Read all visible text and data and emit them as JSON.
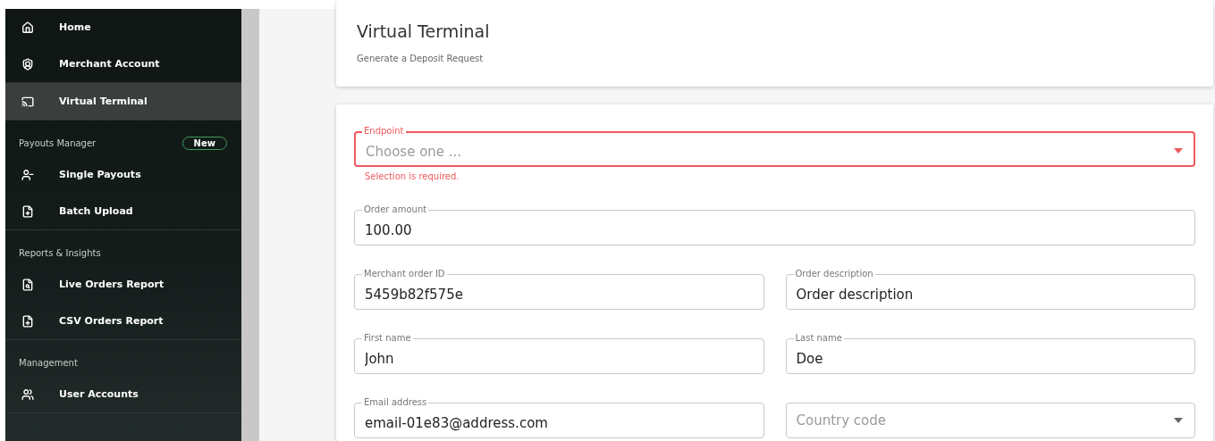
{
  "sidebar": {
    "sections": [
      {
        "items": [
          {
            "label": "Home",
            "selected": false
          },
          {
            "label": "Merchant Account",
            "selected": false
          }
        ]
      },
      {
        "items": [
          {
            "label": "Virtual Terminal",
            "selected": true
          }
        ]
      },
      {
        "heading": "Payouts Manager",
        "badge": "New",
        "items": [
          {
            "label": "Single Payouts",
            "selected": false
          },
          {
            "label": "Batch Upload",
            "selected": false
          }
        ]
      },
      {
        "heading": "Reports & Insights",
        "items": [
          {
            "label": "Live Orders Report",
            "selected": false
          },
          {
            "label": "CSV Orders Report",
            "selected": false
          }
        ]
      },
      {
        "heading": "Management",
        "items": [
          {
            "label": "User Accounts",
            "selected": false
          }
        ]
      }
    ]
  },
  "header": {
    "title": "Virtual Terminal",
    "subtitle": "Generate a Deposit Request"
  },
  "form": {
    "rows": [
      [
        {
          "kind": "select",
          "label": "Endpoint",
          "placeholder": "Choose one ...",
          "error": "Selection is required."
        }
      ],
      [
        {
          "kind": "text",
          "label": "Order amount",
          "value": "100.00"
        }
      ],
      [
        {
          "kind": "text",
          "label": "Merchant order ID",
          "value": "5459b82f575e"
        },
        {
          "kind": "text",
          "label": "Order description",
          "value": "Order description"
        }
      ],
      [
        {
          "kind": "text",
          "label": "First name",
          "value": "John"
        },
        {
          "kind": "text",
          "label": "Last name",
          "value": "Doe"
        }
      ],
      [
        {
          "kind": "text",
          "label": "Email address",
          "value": "email-01e83@address.com"
        },
        {
          "kind": "select",
          "placeholder": "Country code"
        }
      ]
    ]
  }
}
